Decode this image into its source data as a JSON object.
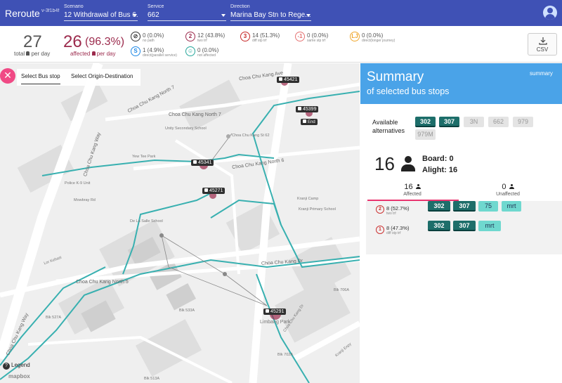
{
  "header": {
    "app_title": "Reroute",
    "app_version": "v-3f1b4f",
    "scenario": {
      "label": "Scenario",
      "value": "12 Withdrawal of Bus 6..."
    },
    "service": {
      "label": "Service",
      "value": "662"
    },
    "direction": {
      "label": "Direction",
      "value": "Marina Bay Stn to Rege..."
    }
  },
  "stats": {
    "total": "27",
    "total_label": "total",
    "per_day": "per day",
    "affected": "26",
    "affected_pct": "(96.3%)",
    "affected_label": "affected",
    "items": [
      {
        "icon": "no-path-icon",
        "symbol": "⊘",
        "value": "0 (0.0%)",
        "label": "no path",
        "color": "#333333"
      },
      {
        "icon": "two-transfer-icon",
        "symbol": "2",
        "value": "12 (43.8%)",
        "label": "two trf",
        "color": "#9c2b4d"
      },
      {
        "icon": "diff-stop-transfer-icon",
        "symbol": "3",
        "value": "14 (51.3%)",
        "label": "diff stp trf",
        "color": "#c62828"
      },
      {
        "icon": "same-stop-transfer-icon",
        "symbol": "-1",
        "value": "0 (0.0%)",
        "label": "same stp trf",
        "color": "#e57373"
      },
      {
        "icon": "direct-longer-icon",
        "symbol": "LJ",
        "value": "0 (0.0%)",
        "label": "direct(longer journey)",
        "color": "#f0a830"
      },
      {
        "icon": "direct-parallel-icon",
        "symbol": "S",
        "value": "1 (4.9%)",
        "label": "direct(parallel service)",
        "color": "#1e88e5"
      },
      {
        "icon": "not-affected-icon",
        "symbol": "☺",
        "value": "0 (0.0%)",
        "label": "not affected",
        "color": "#26a69a"
      }
    ],
    "csv_label": "CSV"
  },
  "map": {
    "tabs": [
      "Select Bus stop",
      "Select Origin-Destination"
    ],
    "stops": [
      "45421",
      "45399",
      "45341",
      "45271",
      "45291"
    ],
    "end_label": "End",
    "legend_label": "Legend",
    "attribution": "mapbox",
    "labels": {
      "choa_north7": "Choa Chu Kang North 7",
      "choa_north5": "Choa Chu Kang North 5",
      "choa_st62": "Choa Chu Kang St 62",
      "choa_north6": "Choa Chu Kang North 6",
      "choa_way": "Choa Chu Kang Way",
      "choa_way2": "Choa Chu Kang Way",
      "choa_dr": "Choa Chu Kang Dr",
      "choa_dr2": "Choa Chu Kang Dr",
      "choa_ave": "Choa Chu Kang Ave",
      "lor_kebasi": "Lor Kebasi",
      "unity_sec": "Unity Secondary School",
      "kranji_pri": "Kranji Primary School",
      "yew_tee": "Yew Tee Park",
      "police": "Police K-9 Unit",
      "mowbray": "Mowbray Rd",
      "de_la_salle": "De La Salle School",
      "limbang": "Limbang Park",
      "blk_527a": "Blk 527A",
      "blk_533a": "Blk 533A",
      "blk_513a": "Blk 513A",
      "blk_706a": "Blk 706A",
      "blk_702a": "Blk 702A",
      "kranji_exp": "Kranji Expy",
      "kranji_camp": "Kranji Camp"
    }
  },
  "summary": {
    "title": "Summary",
    "subtitle": "of selected bus stops",
    "link": "summary",
    "available_label_1": "Available",
    "available_label_2": "alternatives",
    "alternatives": [
      {
        "label": "302",
        "style": "dk"
      },
      {
        "label": "307",
        "style": "dk"
      },
      {
        "label": "3N",
        "style": "gr"
      },
      {
        "label": "662",
        "style": "gr"
      },
      {
        "label": "979",
        "style": "gr"
      },
      {
        "label": "979M",
        "style": "gr"
      }
    ],
    "count": "16",
    "board": "Board: 0",
    "alight": "Alight: 16",
    "tabs": [
      {
        "count": "16",
        "label": "Affected"
      },
      {
        "count": "0",
        "label": "Unaffected"
      }
    ],
    "rows": [
      {
        "symbol": "2",
        "value": "8 (52.7%)",
        "label": "two trf",
        "chips": [
          "302",
          "307",
          "75",
          "mrt"
        ]
      },
      {
        "symbol": "1",
        "value": "8 (47.3%)",
        "label": "diff stp trf",
        "chips": [
          "302",
          "307",
          "mrt"
        ]
      }
    ]
  },
  "colors": {
    "header": "#3f51b5",
    "summary_header": "#4aa3e8",
    "route": "#38b0b0",
    "accent": "#e9346f"
  }
}
